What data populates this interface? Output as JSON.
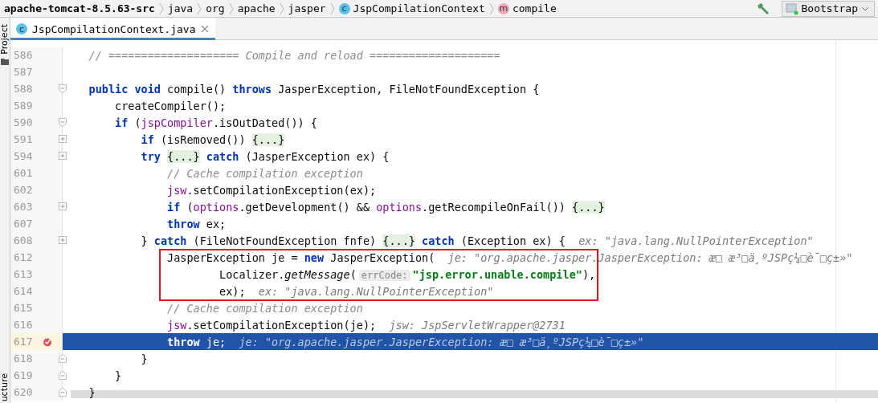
{
  "breadcrumbs": [
    {
      "label": "apache-tomcat-8.5.63-src",
      "kind": "project"
    },
    {
      "label": "java",
      "kind": "folder"
    },
    {
      "label": "org",
      "kind": "folder"
    },
    {
      "label": "apache",
      "kind": "folder"
    },
    {
      "label": "jasper",
      "kind": "folder"
    },
    {
      "label": "JspCompilationContext",
      "kind": "class",
      "icon_letter": "c"
    },
    {
      "label": "compile",
      "kind": "method",
      "icon_letter": "m"
    }
  ],
  "run_config": {
    "label": "Bootstrap"
  },
  "side_strip": {
    "top_label": "Project",
    "bottom_label": "ucture"
  },
  "tabs": [
    {
      "label": "JspCompilationContext.java",
      "icon_letter": "c",
      "selected": true
    }
  ],
  "lines": [
    {
      "number": "586",
      "breakpoint": false,
      "selected": false,
      "framed": false,
      "segments": [
        {
          "kind": "comment",
          "text": "    // ==================== Compile and reload ===================="
        }
      ]
    },
    {
      "number": "587",
      "breakpoint": false,
      "selected": false,
      "framed": false
    },
    {
      "number": "588",
      "fold": {
        "kind": "collapse"
      },
      "breakpoint": false,
      "selected": false,
      "framed": false,
      "segments": [
        {
          "kind": "kw",
          "text": "    public void "
        },
        {
          "kind": "plain",
          "text": "compile() "
        },
        {
          "kind": "kw",
          "text": "throws "
        },
        {
          "kind": "plain",
          "text": "JasperException, FileNotFoundException {"
        }
      ]
    },
    {
      "number": "589",
      "breakpoint": false,
      "selected": false,
      "framed": false,
      "segments": [
        {
          "kind": "plain",
          "text": "        createCompiler();"
        }
      ]
    },
    {
      "number": "590",
      "fold": {
        "kind": "collapse"
      },
      "breakpoint": false,
      "selected": false,
      "framed": false,
      "segments": [
        {
          "kind": "kw",
          "text": "        if "
        },
        {
          "kind": "plain",
          "text": "("
        },
        {
          "kind": "field",
          "text": "jspCompiler"
        },
        {
          "kind": "plain",
          "text": ".isOutDated()) {"
        }
      ]
    },
    {
      "number": "591",
      "fold": {
        "kind": "expand"
      },
      "breakpoint": false,
      "selected": false,
      "framed": false,
      "segments": [
        {
          "kind": "kw",
          "text": "            if "
        },
        {
          "kind": "plain",
          "text": "(isRemoved()) "
        },
        {
          "kind": "folded",
          "text": "{...}"
        }
      ]
    },
    {
      "number": "594",
      "fold": {
        "kind": "expand"
      },
      "breakpoint": false,
      "selected": false,
      "framed": false,
      "segments": [
        {
          "kind": "kw",
          "text": "            try "
        },
        {
          "kind": "folded",
          "text": "{...}"
        },
        {
          "kind": "kw",
          "text": " catch "
        },
        {
          "kind": "plain",
          "text": "(JasperException ex) {"
        }
      ]
    },
    {
      "number": "601",
      "breakpoint": false,
      "selected": false,
      "framed": false,
      "segments": [
        {
          "kind": "comment",
          "text": "                // Cache compilation exception"
        }
      ]
    },
    {
      "number": "602",
      "breakpoint": false,
      "selected": false,
      "framed": false,
      "segments": [
        {
          "kind": "field",
          "text": "                jsw"
        },
        {
          "kind": "plain",
          "text": ".setCompilationException(ex);"
        }
      ]
    },
    {
      "number": "603",
      "fold": {
        "kind": "expand"
      },
      "breakpoint": false,
      "selected": false,
      "framed": false,
      "segments": [
        {
          "kind": "kw",
          "text": "                if "
        },
        {
          "kind": "plain",
          "text": "("
        },
        {
          "kind": "field",
          "text": "options"
        },
        {
          "kind": "plain",
          "text": ".getDevelopment() && "
        },
        {
          "kind": "field",
          "text": "options"
        },
        {
          "kind": "plain",
          "text": ".getRecompileOnFail()) "
        },
        {
          "kind": "folded",
          "text": "{...}"
        }
      ]
    },
    {
      "number": "607",
      "breakpoint": false,
      "selected": false,
      "framed": false,
      "segments": [
        {
          "kind": "kw",
          "text": "                throw "
        },
        {
          "kind": "plain",
          "text": "ex;"
        }
      ]
    },
    {
      "number": "608",
      "fold": {
        "kind": "expand"
      },
      "breakpoint": false,
      "selected": false,
      "framed": false,
      "segments": [
        {
          "kind": "plain",
          "text": "            } "
        },
        {
          "kind": "kw",
          "text": "catch "
        },
        {
          "kind": "plain",
          "text": "(FileNotFoundException fnfe) "
        },
        {
          "kind": "folded",
          "text": "{...}"
        },
        {
          "kind": "kw",
          "text": " catch "
        },
        {
          "kind": "plain",
          "text": "(Exception ex) {"
        }
      ],
      "debug": "ex: \"java.lang.NullPointerException\""
    },
    {
      "number": "612",
      "breakpoint": false,
      "selected": false,
      "framed": true,
      "segments": [
        {
          "kind": "plain",
          "text": "                JasperException je = "
        },
        {
          "kind": "kw",
          "text": "new "
        },
        {
          "kind": "plain",
          "text": "JasperException("
        }
      ],
      "debug": "je: \"org.apache.jasper.JasperException: æ□ æ³□ä¸ºJSPç¼□è¯□ç±»\""
    },
    {
      "number": "613",
      "breakpoint": false,
      "selected": false,
      "framed": true,
      "segments": [
        {
          "kind": "plain",
          "text": "                        Localizer."
        },
        {
          "kind": "method",
          "text": "getMessage"
        },
        {
          "kind": "plain",
          "text": "("
        },
        {
          "kind": "hint",
          "text": "errCode:"
        },
        {
          "kind": "str",
          "text": "\"jsp.error.unable.compile\""
        },
        {
          "kind": "plain",
          "text": "),"
        }
      ]
    },
    {
      "number": "614",
      "breakpoint": false,
      "selected": false,
      "framed": true,
      "segments": [
        {
          "kind": "plain",
          "text": "                        ex);"
        }
      ],
      "debug": "ex: \"java.lang.NullPointerException\""
    },
    {
      "number": "615",
      "breakpoint": false,
      "selected": false,
      "framed": false,
      "segments": [
        {
          "kind": "comment",
          "text": "                // Cache compilation exception"
        }
      ]
    },
    {
      "number": "616",
      "breakpoint": false,
      "selected": false,
      "framed": false,
      "segments": [
        {
          "kind": "field",
          "text": "                jsw"
        },
        {
          "kind": "plain",
          "text": ".setCompilationException(je);"
        }
      ],
      "debug": "jsw: JspServletWrapper@2731"
    },
    {
      "number": "617",
      "breakpoint": true,
      "selected": true,
      "framed": false,
      "segments": [
        {
          "kind": "kw",
          "text": "                throw "
        },
        {
          "kind": "plain",
          "text": "je;"
        }
      ],
      "debug": "je: \"org.apache.jasper.JasperException: æ□ æ³□ä¸ºJSPç¼□è¯□ç±»\""
    },
    {
      "number": "618",
      "fold": {
        "kind": "end"
      },
      "breakpoint": false,
      "selected": false,
      "framed": false,
      "segments": [
        {
          "kind": "plain",
          "text": "            }"
        }
      ]
    },
    {
      "number": "619",
      "fold": {
        "kind": "end"
      },
      "breakpoint": false,
      "selected": false,
      "framed": false,
      "segments": [
        {
          "kind": "plain",
          "text": "        }"
        }
      ]
    },
    {
      "number": "620",
      "fold": {
        "kind": "end"
      },
      "breakpoint": false,
      "selected": false,
      "framed": false,
      "segments": [
        {
          "kind": "plain",
          "text": "    }"
        }
      ]
    }
  ]
}
